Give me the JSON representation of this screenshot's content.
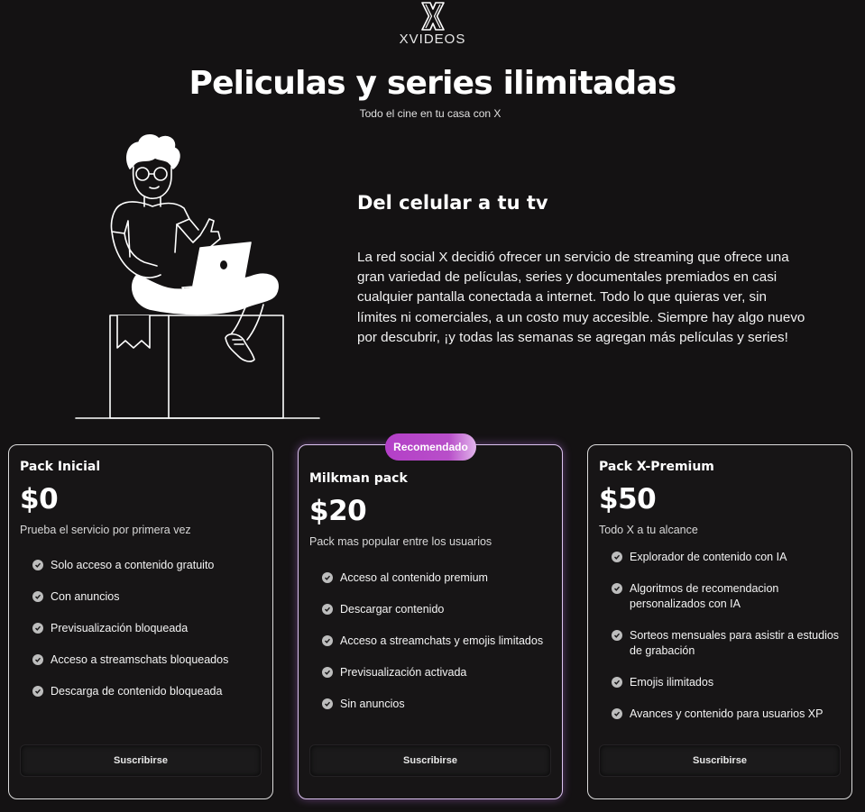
{
  "brand": {
    "name": "XVIDEOS",
    "logo_icon": "x-logo-icon"
  },
  "hero": {
    "title": "Peliculas y series ilimitadas",
    "subtitle": "Todo el cine en tu casa con X"
  },
  "about": {
    "title": "Del celular a tu tv",
    "text": "La red social X decidió ofrecer un servicio de streaming que ofrece una gran variedad de películas, series y documentales premiados en casi cualquier pantalla conectada a internet. Todo lo que quieras ver, sin límites ni comerciales, a un costo muy accesible. Siempre hay algo nuevo por descubrir, ¡y todas las semanas se agregan más películas y series!"
  },
  "colors": {
    "background": "#141213",
    "badge": "#b43fc8",
    "featured_border": "#dcc3f0"
  },
  "plans": [
    {
      "name": "Pack Inicial",
      "price": "$0",
      "description": "Prueba el servicio por primera vez",
      "features": [
        "Solo acceso a contenido gratuito",
        "Con anuncios",
        "Previsualización bloqueada",
        "Acceso a streamschats bloqueados",
        "Descarga de contenido bloqueada"
      ],
      "button": "Suscribirse"
    },
    {
      "name": "Milkman pack",
      "badge": "Recomendado",
      "price": "$20",
      "description": "Pack mas popular entre los usuarios",
      "features": [
        "Acceso al contenido premium",
        "Descargar contenido",
        "Acceso a streamchats y emojis limitados",
        "Previsualización activada",
        "Sin anuncios"
      ],
      "button": "Suscribirse"
    },
    {
      "name": "Pack X-Premium",
      "price": "$50",
      "description": "Todo X a tu alcance",
      "features": [
        "Explorador de contenido con IA",
        "Algoritmos de recomendacion personalizados con IA",
        "Sorteos mensuales para asistir a estudios de grabación",
        "Emojis ilimitados",
        "Avances y contenido para usuarios XP"
      ],
      "button": "Suscribirse"
    }
  ]
}
